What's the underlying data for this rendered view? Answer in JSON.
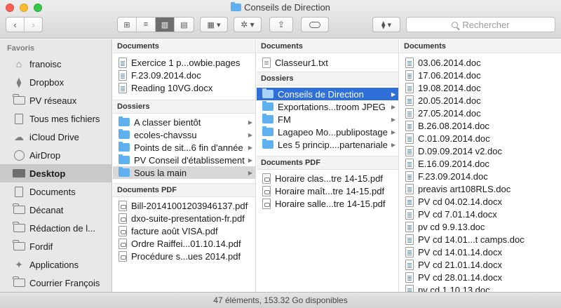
{
  "window": {
    "title": "Conseils de Direction"
  },
  "toolbar": {
    "back_glyph": "‹",
    "forward_glyph": "›",
    "view_icon_glyph": "⊞",
    "view_list_glyph": "≡",
    "view_column_glyph": "▥",
    "view_coverflow_glyph": "▤",
    "arrange_glyph": "▦ ▾",
    "action_glyph": "✲ ▾",
    "share_glyph": "⇪",
    "dropbox_glyph": "⧫ ▾"
  },
  "search": {
    "placeholder": "Rechercher"
  },
  "sidebar": {
    "header": "Favoris",
    "items": [
      {
        "label": "franoisc",
        "icon": "home-icon"
      },
      {
        "label": "Dropbox",
        "icon": "dropbox-icon"
      },
      {
        "label": "PV réseaux",
        "icon": "folder-icon"
      },
      {
        "label": "Tous mes fichiers",
        "icon": "all-files-icon"
      },
      {
        "label": "iCloud Drive",
        "icon": "cloud-icon"
      },
      {
        "label": "AirDrop",
        "icon": "airdrop-icon"
      },
      {
        "label": "Desktop",
        "icon": "desktop-icon",
        "active": true
      },
      {
        "label": "Documents",
        "icon": "document-icon"
      },
      {
        "label": "Décanat",
        "icon": "folder-icon"
      },
      {
        "label": "Rédaction de l...",
        "icon": "folder-icon"
      },
      {
        "label": "Fordif",
        "icon": "folder-icon"
      },
      {
        "label": "Applications",
        "icon": "applications-icon"
      },
      {
        "label": "Courrier François",
        "icon": "folder-icon"
      }
    ]
  },
  "columns": {
    "col1": {
      "documents_header": "Documents",
      "documents": [
        "Exercice 1 p...owbie.pages",
        "F.23.09.2014.doc",
        "Reading 10VG.docx"
      ],
      "folders_header": "Dossiers",
      "folders": [
        "A classer bientôt",
        "ecoles-chavssu",
        "Points de sit...6 fin d'année",
        "PV Conseil d'établissement",
        "Sous la main"
      ],
      "pdf_header": "Documents PDF",
      "pdfs": [
        "Bill-20141001203946137.pdf",
        "dxo-suite-presentation-fr.pdf",
        "facture août VISA.pdf",
        "Ordre Raiffei...01.10.14.pdf",
        "Procédure s...ues 2014.pdf"
      ]
    },
    "col2": {
      "documents_header": "Documents",
      "documents": [
        "Classeur1.txt"
      ],
      "folders_header": "Dossiers",
      "folders": [
        "Conseils de Direction",
        "Exportations...troom JPEG",
        "FM",
        "Lagapeo Mo...publipostage",
        "Les 5 princip....partenariale"
      ],
      "pdf_header": "Documents PDF",
      "pdfs": [
        "Horaire clas...tre 14-15.pdf",
        "Horaire maît...tre 14-15.pdf",
        "Horaire salle...tre 14-15.pdf"
      ]
    },
    "col3": {
      "documents_header": "Documents",
      "documents": [
        "03.06.2014.doc",
        "17.06.2014.doc",
        "19.08.2014.doc",
        "20.05.2014.doc",
        "27.05.2014.doc",
        "B.26.08.2014.doc",
        "C.01.09.2014.doc",
        "D.09.09.2014 v2.doc",
        "E.16.09.2014.doc",
        "F.23.09.2014.doc",
        "preavis art108RLS.doc",
        "PV cd  04.02.14.docx",
        "PV cd  7.01.14.docx",
        "pv cd  9.9.13.doc",
        "PV cd  14.01...t camps.doc",
        "PV cd  14.01.14.docx",
        "PV cd  21.01.14.docx",
        "PV cd  28.01.14.docx",
        "pv cd 1.10.13.doc"
      ]
    }
  },
  "status": {
    "text": "47 éléments, 153.32 Go disponibles"
  }
}
